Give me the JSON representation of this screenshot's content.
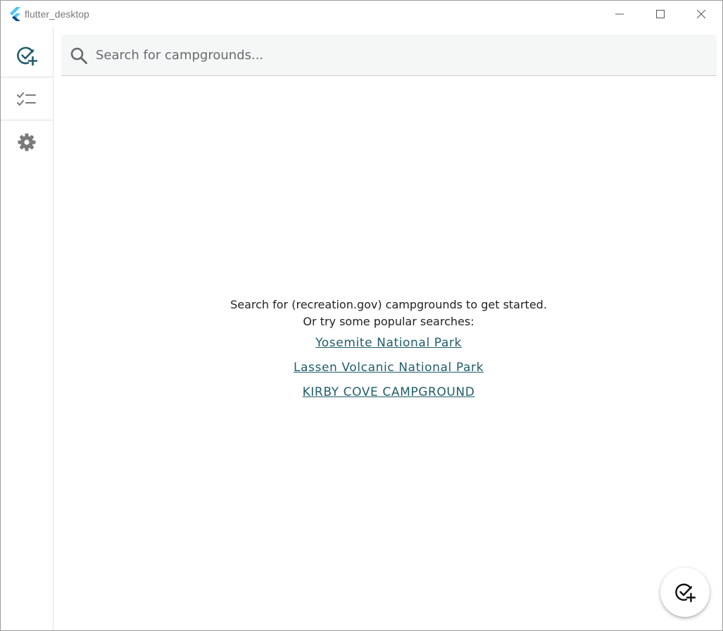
{
  "window": {
    "title": "flutter_desktop",
    "logo_icon": "flutter-logo",
    "controls": {
      "minimize_icon": "minimize-icon",
      "maximize_icon": "maximize-icon",
      "close_icon": "close-icon"
    }
  },
  "sidebar": {
    "items": [
      {
        "icon": "check-circle-add-icon",
        "selected": true
      },
      {
        "icon": "checklist-icon",
        "selected": false
      },
      {
        "icon": "gear-icon",
        "selected": false
      }
    ]
  },
  "search": {
    "placeholder": "Search for campgrounds...",
    "value": "",
    "icon": "search-icon"
  },
  "empty_state": {
    "line1": "Search for (recreation.gov) campgrounds to get started.",
    "line2": "Or try some popular searches:",
    "popular_searches": [
      "Yosemite National Park",
      "Lassen Volcanic National Park",
      "KIRBY COVE CAMPGROUND"
    ]
  },
  "fab": {
    "icon": "check-circle-add-icon"
  },
  "colors": {
    "accent": "#1f5d6a",
    "icon_gray": "#7a7a7a",
    "search_bg": "#f5f7f7"
  }
}
